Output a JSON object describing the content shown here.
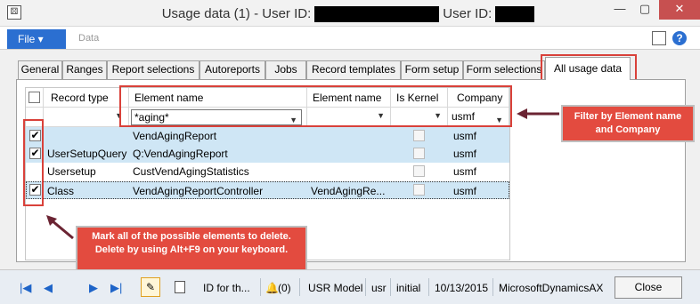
{
  "window": {
    "title_prefix": "Usage data (1) - User ID:",
    "title_mid": "User ID:",
    "minimize_icon": "minimize-icon",
    "maximize_icon": "maximize-icon",
    "close_icon": "close-icon"
  },
  "ribbon": {
    "file_label": "File",
    "data_label": "Data"
  },
  "tabs": [
    "General",
    "Ranges",
    "Report selections",
    "Autoreports",
    "Jobs",
    "Record templates",
    "Form setup",
    "Form selections",
    "All usage data"
  ],
  "active_tab": "All usage data",
  "grid": {
    "headers": {
      "record_type": "Record type",
      "element_name": "Element name",
      "element_name2": "Element name",
      "is_kernel": "Is Kernel",
      "company": "Company"
    },
    "filter": {
      "element_name": "*aging*",
      "company": "usmf"
    },
    "rows": [
      {
        "checked": true,
        "record_type": "",
        "element_name": "VendAgingReport",
        "element_name2": "",
        "company": "usmf"
      },
      {
        "checked": true,
        "record_type": "UserSetupQuery",
        "element_name": "Q:VendAgingReport",
        "element_name2": "",
        "company": "usmf"
      },
      {
        "checked": false,
        "record_type": "Usersetup",
        "element_name": "CustVendAgingStatistics",
        "element_name2": "",
        "company": "usmf"
      },
      {
        "checked": true,
        "record_type": "Class",
        "element_name": "VendAgingReportController",
        "element_name2": "VendAgingRe...",
        "company": "usmf"
      }
    ]
  },
  "callouts": {
    "filter_note": "Filter by Element name and Company",
    "delete_note_1": "Mark all of the possible elements to delete.",
    "delete_note_2": "Delete by using Alt+F9 on your keyboard."
  },
  "status": {
    "id_for": "ID for th...",
    "notifications": "(0)",
    "model": "USR Model",
    "layer": "usr",
    "state": "initial",
    "date": "10/13/2015",
    "product": "MicrosoftDynamicsAX",
    "close_label": "Close"
  },
  "colors": {
    "accent": "#2b6fd1",
    "callout": "#e34b3f",
    "highlight": "#d9413a",
    "selected_row": "#cfe6f5"
  }
}
